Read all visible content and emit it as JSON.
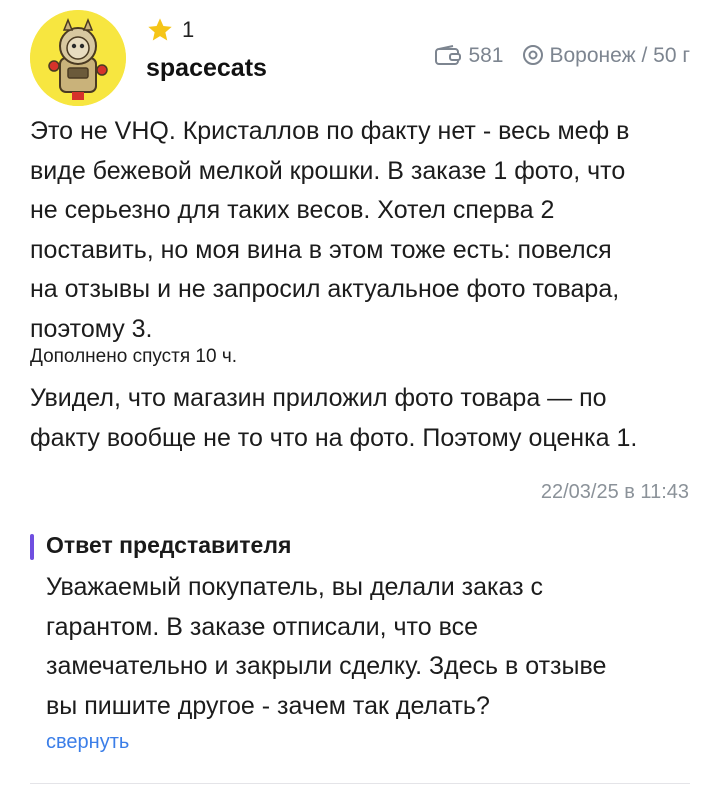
{
  "review": {
    "author": {
      "rating_count": "1",
      "username": "spacecats",
      "avatar_icon": "cat-astronaut-avatar"
    },
    "meta": {
      "deals_count": "581",
      "location": "Воронеж / 50 г"
    },
    "text": "Это не VHQ. Кристаллов по факту нет - весь меф в\nвиде бежевой мелкой крошки. В заказе 1 фото, что\nне серьезно для таких весов. Хотел сперва 2\nпоставить, но моя вина в этом тоже есть: повелся\nна отзывы и не запросил актуальное фото товара,\nпоэтому 3.",
    "addendum_label": "Дополнено спустя 10 ч.",
    "addendum_text": "Увидел, что магазин приложил фото товара — по\nфакту вообще не то что на фото. Поэтому оценка 1.",
    "date": "22/03/25 в 11:43"
  },
  "reply": {
    "title": "Ответ представителя",
    "text": "Уважаемый покупатель, вы делали заказ с\nгарантом. В заказе отписали, что все\nзамечательно и закрыли сделку. Здесь в отзыве\nвы пишите другое - зачем так делать?",
    "collapse_label": "свернуть"
  },
  "colors": {
    "accent_bar": "#6f4fe0",
    "link": "#3b7ee8",
    "star": "#f5c518",
    "muted": "#7d8590"
  }
}
